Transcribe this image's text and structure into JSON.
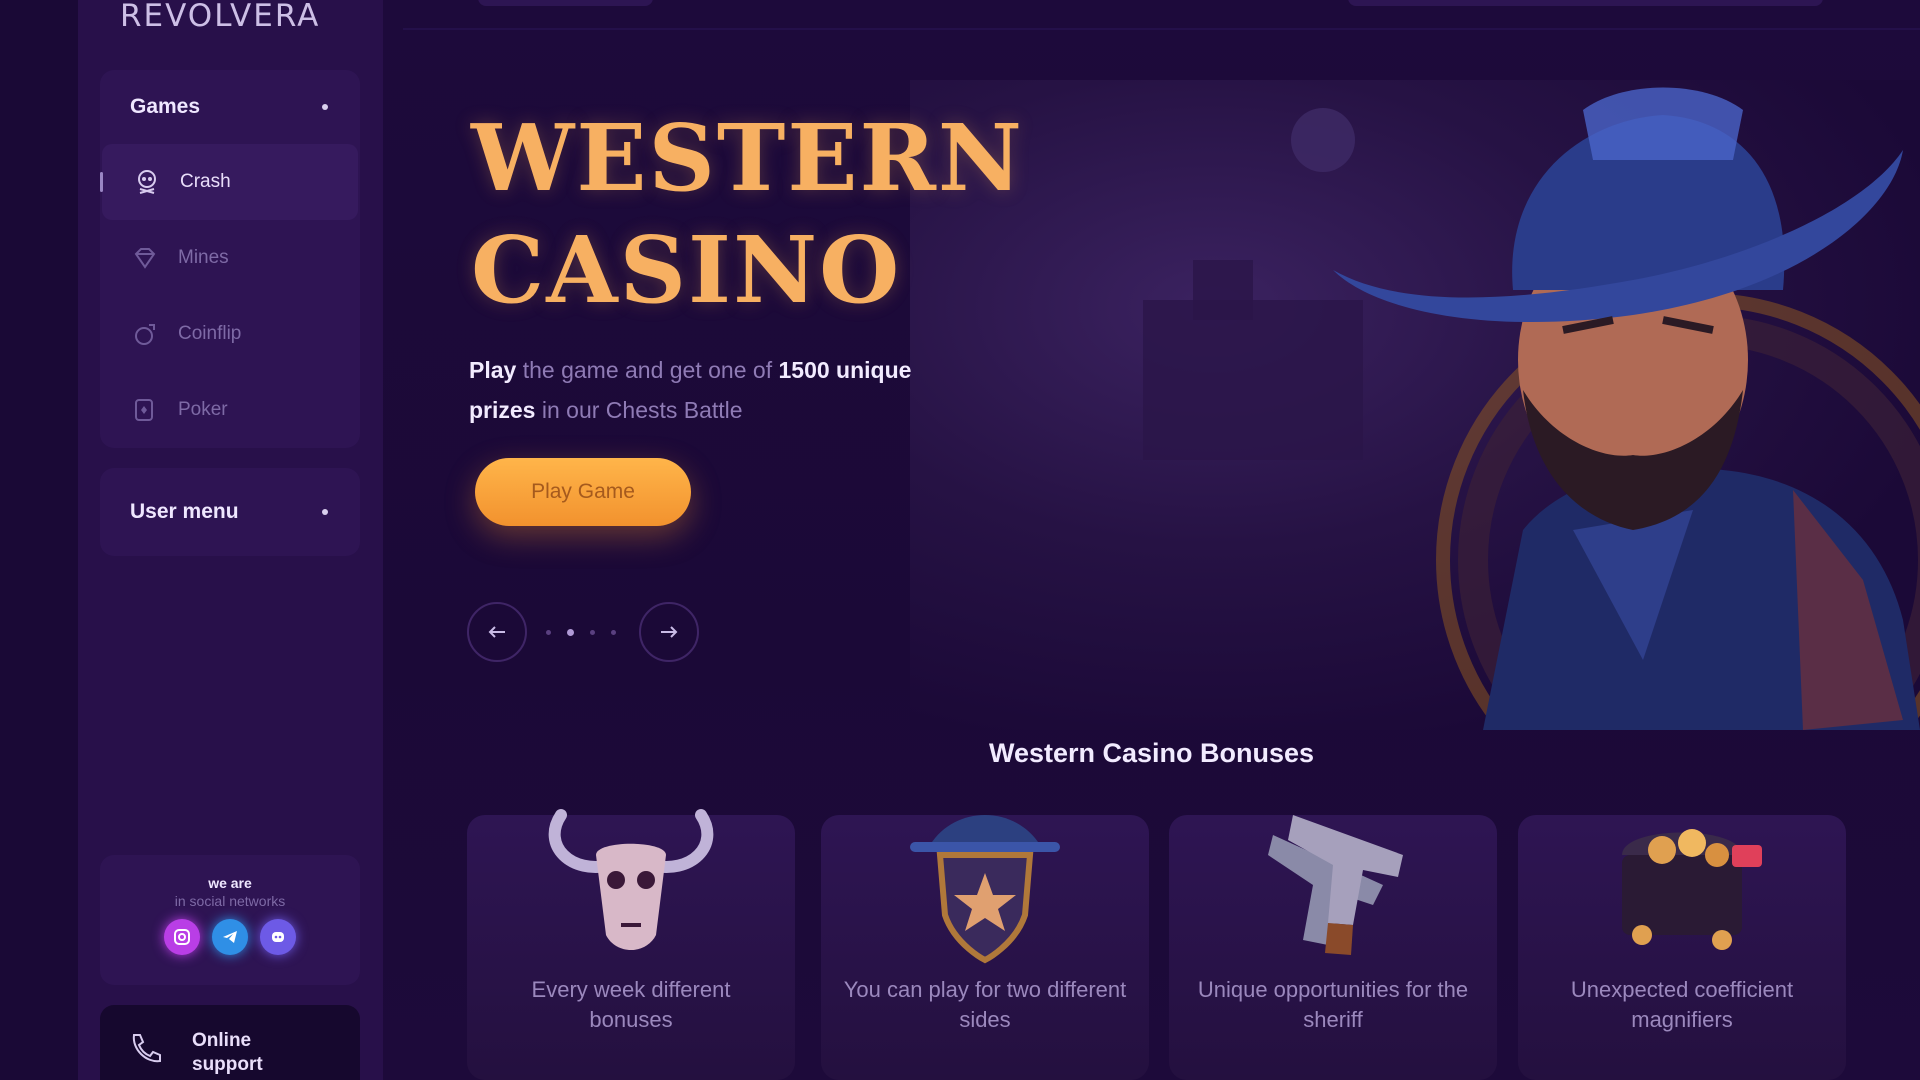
{
  "brand": {
    "logo": "REVOLVERA"
  },
  "sidebar": {
    "games_label": "Games",
    "games": [
      {
        "label": "Crash",
        "icon": "skull-icon",
        "active": true
      },
      {
        "label": "Mines",
        "icon": "diamond-icon",
        "active": false
      },
      {
        "label": "Coinflip",
        "icon": "coinflip-icon",
        "active": false
      },
      {
        "label": "Poker",
        "icon": "cards-icon",
        "active": false
      }
    ],
    "user_menu_label": "User menu",
    "social": {
      "title": "we are",
      "subtitle": "in social networks",
      "networks": [
        {
          "icon": "instagram-icon",
          "color": "#d44cff"
        },
        {
          "icon": "telegram-icon",
          "color": "#3aa6ff"
        },
        {
          "icon": "discord-icon",
          "color": "#7b6bff"
        }
      ]
    },
    "support_label": "Online support"
  },
  "hero": {
    "title_line1": "WESTERN",
    "title_line2": "CASINO",
    "desc_bold1": "Play",
    "desc_text1": " the game and get one of ",
    "desc_bold2": "1500 unique prizes",
    "desc_text2": " in our Chests Battle",
    "cta_label": "Play Game",
    "slide_count": 4,
    "active_slide": 2
  },
  "bonuses": {
    "title": "Western Casino Bonuses",
    "items": [
      {
        "text": "Every week different bonuses",
        "icon": "bull-skull-icon"
      },
      {
        "text": "You can play for two different sides",
        "icon": "sheriff-badge-icon"
      },
      {
        "text": "Unique opportunities for the sheriff",
        "icon": "revolvers-icon"
      },
      {
        "text": "Unexpected coefficient magnifiers",
        "icon": "treasure-chest-icon"
      }
    ]
  },
  "colors": {
    "accent": "#f7a94c",
    "background": "#1e0a3c",
    "sidebar": "#28104a"
  }
}
